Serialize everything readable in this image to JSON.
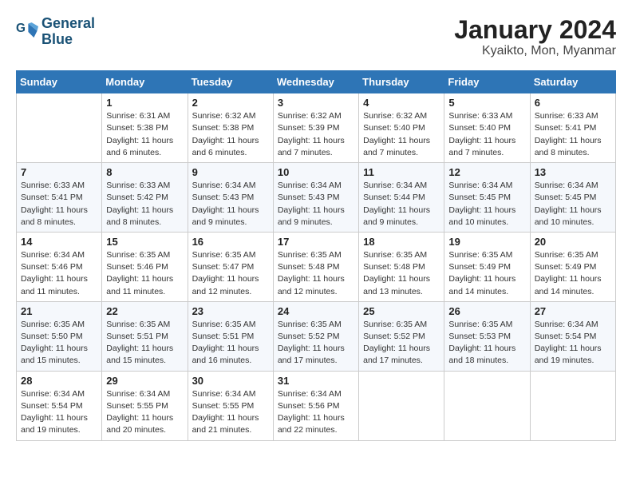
{
  "logo": {
    "line1": "General",
    "line2": "Blue"
  },
  "title": "January 2024",
  "location": "Kyaikto, Mon, Myanmar",
  "headers": [
    "Sunday",
    "Monday",
    "Tuesday",
    "Wednesday",
    "Thursday",
    "Friday",
    "Saturday"
  ],
  "weeks": [
    [
      {
        "day": "",
        "info": ""
      },
      {
        "day": "1",
        "info": "Sunrise: 6:31 AM\nSunset: 5:38 PM\nDaylight: 11 hours\nand 6 minutes."
      },
      {
        "day": "2",
        "info": "Sunrise: 6:32 AM\nSunset: 5:38 PM\nDaylight: 11 hours\nand 6 minutes."
      },
      {
        "day": "3",
        "info": "Sunrise: 6:32 AM\nSunset: 5:39 PM\nDaylight: 11 hours\nand 7 minutes."
      },
      {
        "day": "4",
        "info": "Sunrise: 6:32 AM\nSunset: 5:40 PM\nDaylight: 11 hours\nand 7 minutes."
      },
      {
        "day": "5",
        "info": "Sunrise: 6:33 AM\nSunset: 5:40 PM\nDaylight: 11 hours\nand 7 minutes."
      },
      {
        "day": "6",
        "info": "Sunrise: 6:33 AM\nSunset: 5:41 PM\nDaylight: 11 hours\nand 8 minutes."
      }
    ],
    [
      {
        "day": "7",
        "info": "Sunrise: 6:33 AM\nSunset: 5:41 PM\nDaylight: 11 hours\nand 8 minutes."
      },
      {
        "day": "8",
        "info": "Sunrise: 6:33 AM\nSunset: 5:42 PM\nDaylight: 11 hours\nand 8 minutes."
      },
      {
        "day": "9",
        "info": "Sunrise: 6:34 AM\nSunset: 5:43 PM\nDaylight: 11 hours\nand 9 minutes."
      },
      {
        "day": "10",
        "info": "Sunrise: 6:34 AM\nSunset: 5:43 PM\nDaylight: 11 hours\nand 9 minutes."
      },
      {
        "day": "11",
        "info": "Sunrise: 6:34 AM\nSunset: 5:44 PM\nDaylight: 11 hours\nand 9 minutes."
      },
      {
        "day": "12",
        "info": "Sunrise: 6:34 AM\nSunset: 5:45 PM\nDaylight: 11 hours\nand 10 minutes."
      },
      {
        "day": "13",
        "info": "Sunrise: 6:34 AM\nSunset: 5:45 PM\nDaylight: 11 hours\nand 10 minutes."
      }
    ],
    [
      {
        "day": "14",
        "info": "Sunrise: 6:34 AM\nSunset: 5:46 PM\nDaylight: 11 hours\nand 11 minutes."
      },
      {
        "day": "15",
        "info": "Sunrise: 6:35 AM\nSunset: 5:46 PM\nDaylight: 11 hours\nand 11 minutes."
      },
      {
        "day": "16",
        "info": "Sunrise: 6:35 AM\nSunset: 5:47 PM\nDaylight: 11 hours\nand 12 minutes."
      },
      {
        "day": "17",
        "info": "Sunrise: 6:35 AM\nSunset: 5:48 PM\nDaylight: 11 hours\nand 12 minutes."
      },
      {
        "day": "18",
        "info": "Sunrise: 6:35 AM\nSunset: 5:48 PM\nDaylight: 11 hours\nand 13 minutes."
      },
      {
        "day": "19",
        "info": "Sunrise: 6:35 AM\nSunset: 5:49 PM\nDaylight: 11 hours\nand 14 minutes."
      },
      {
        "day": "20",
        "info": "Sunrise: 6:35 AM\nSunset: 5:49 PM\nDaylight: 11 hours\nand 14 minutes."
      }
    ],
    [
      {
        "day": "21",
        "info": "Sunrise: 6:35 AM\nSunset: 5:50 PM\nDaylight: 11 hours\nand 15 minutes."
      },
      {
        "day": "22",
        "info": "Sunrise: 6:35 AM\nSunset: 5:51 PM\nDaylight: 11 hours\nand 15 minutes."
      },
      {
        "day": "23",
        "info": "Sunrise: 6:35 AM\nSunset: 5:51 PM\nDaylight: 11 hours\nand 16 minutes."
      },
      {
        "day": "24",
        "info": "Sunrise: 6:35 AM\nSunset: 5:52 PM\nDaylight: 11 hours\nand 17 minutes."
      },
      {
        "day": "25",
        "info": "Sunrise: 6:35 AM\nSunset: 5:52 PM\nDaylight: 11 hours\nand 17 minutes."
      },
      {
        "day": "26",
        "info": "Sunrise: 6:35 AM\nSunset: 5:53 PM\nDaylight: 11 hours\nand 18 minutes."
      },
      {
        "day": "27",
        "info": "Sunrise: 6:34 AM\nSunset: 5:54 PM\nDaylight: 11 hours\nand 19 minutes."
      }
    ],
    [
      {
        "day": "28",
        "info": "Sunrise: 6:34 AM\nSunset: 5:54 PM\nDaylight: 11 hours\nand 19 minutes."
      },
      {
        "day": "29",
        "info": "Sunrise: 6:34 AM\nSunset: 5:55 PM\nDaylight: 11 hours\nand 20 minutes."
      },
      {
        "day": "30",
        "info": "Sunrise: 6:34 AM\nSunset: 5:55 PM\nDaylight: 11 hours\nand 21 minutes."
      },
      {
        "day": "31",
        "info": "Sunrise: 6:34 AM\nSunset: 5:56 PM\nDaylight: 11 hours\nand 22 minutes."
      },
      {
        "day": "",
        "info": ""
      },
      {
        "day": "",
        "info": ""
      },
      {
        "day": "",
        "info": ""
      }
    ]
  ]
}
